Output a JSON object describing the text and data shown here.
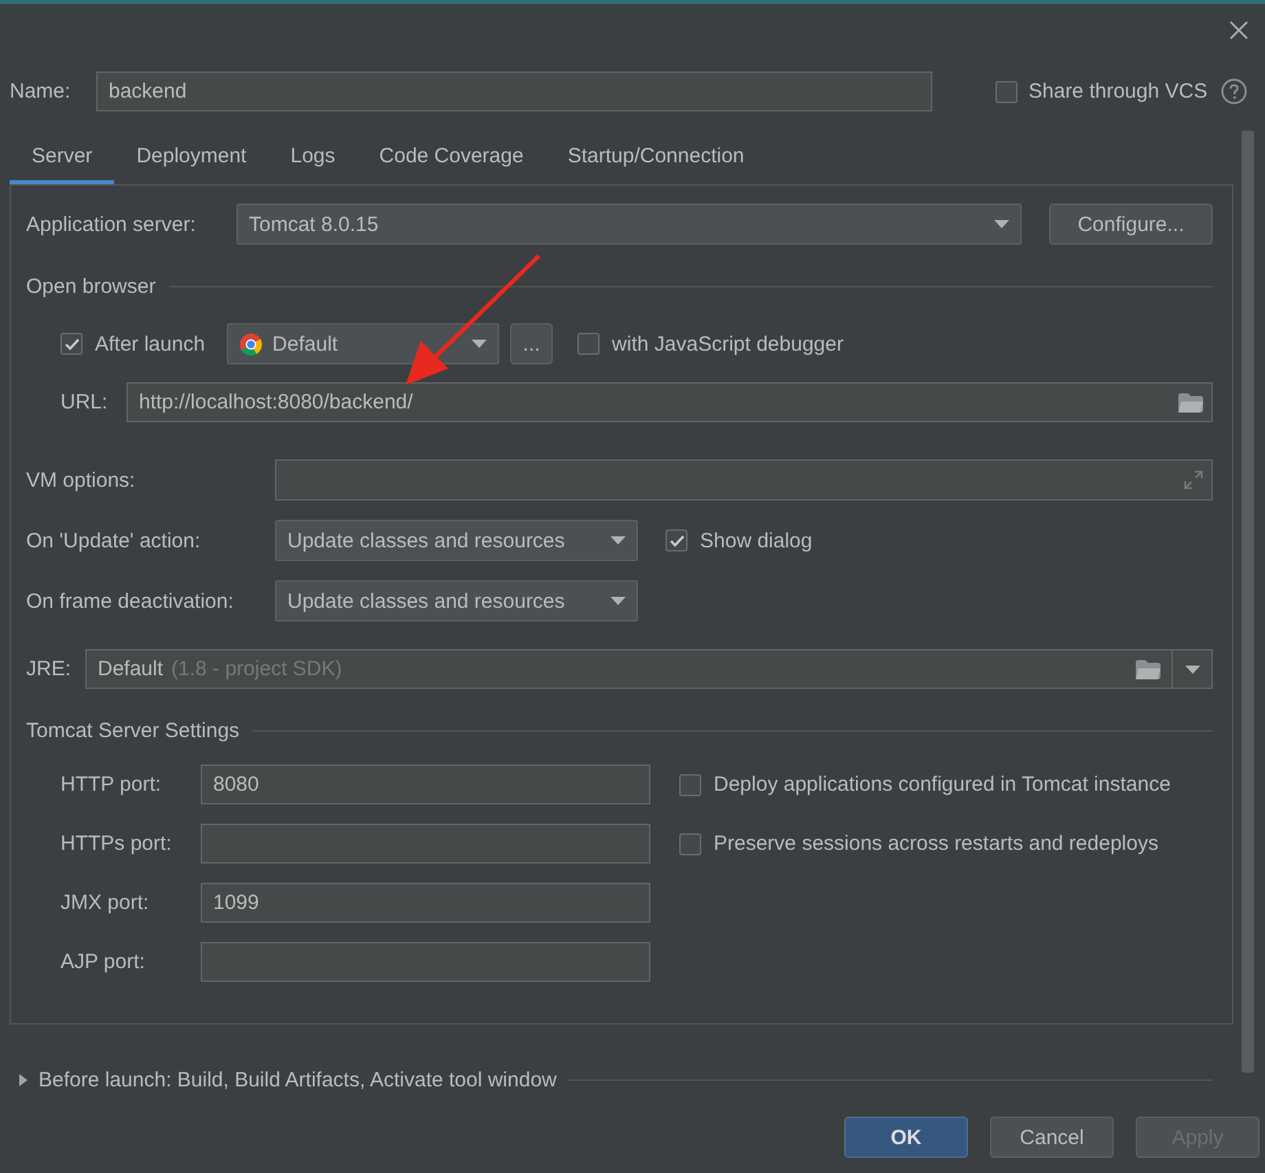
{
  "name_field": {
    "label": "Name:",
    "value": "backend"
  },
  "share_vcs": {
    "label": "Share through VCS",
    "checked": false
  },
  "tabs": [
    {
      "label": "Server",
      "selected": true
    },
    {
      "label": "Deployment",
      "selected": false
    },
    {
      "label": "Logs",
      "selected": false
    },
    {
      "label": "Code Coverage",
      "selected": false
    },
    {
      "label": "Startup/Connection",
      "selected": false
    }
  ],
  "server": {
    "application_server": {
      "label": "Application server:",
      "value": "Tomcat 8.0.15"
    },
    "configure_button": "Configure...",
    "open_browser": {
      "title": "Open browser",
      "after_launch": {
        "label": "After launch",
        "checked": true
      },
      "browser": "Default",
      "more_button": "...",
      "js_debugger": {
        "label": "with JavaScript debugger",
        "checked": false
      },
      "url": {
        "label": "URL:",
        "value": "http://localhost:8080/backend/"
      }
    },
    "vm_options": {
      "label": "VM options:"
    },
    "update_action": {
      "label": "On 'Update' action:",
      "value": "Update classes and resources"
    },
    "show_dialog": {
      "label": "Show dialog",
      "checked": true
    },
    "frame_deactivation": {
      "label": "On frame deactivation:",
      "value": "Update classes and resources"
    },
    "jre": {
      "label": "JRE:",
      "value": "Default",
      "hint": "(1.8 - project SDK)"
    },
    "tomcat_settings": {
      "title": "Tomcat Server Settings",
      "ports": [
        {
          "label": "HTTP port:",
          "value": "8080"
        },
        {
          "label": "HTTPs port:"
        },
        {
          "label": "JMX port:",
          "value": "1099"
        },
        {
          "label": "AJP port:"
        }
      ],
      "options": [
        {
          "label": "Deploy applications configured in Tomcat instance",
          "checked": false
        },
        {
          "label": "Preserve sessions across restarts and redeploys",
          "checked": false
        }
      ]
    }
  },
  "before_launch": {
    "label": "Before launch: Build, Build Artifacts, Activate tool window",
    "expanded": false
  },
  "buttons": [
    {
      "label": "OK",
      "kind": "default",
      "disabled": false
    },
    {
      "label": "Cancel",
      "kind": "normal",
      "disabled": false
    },
    {
      "label": "Apply",
      "kind": "normal",
      "disabled": true
    }
  ],
  "annotation": {
    "kind": "arrow"
  }
}
